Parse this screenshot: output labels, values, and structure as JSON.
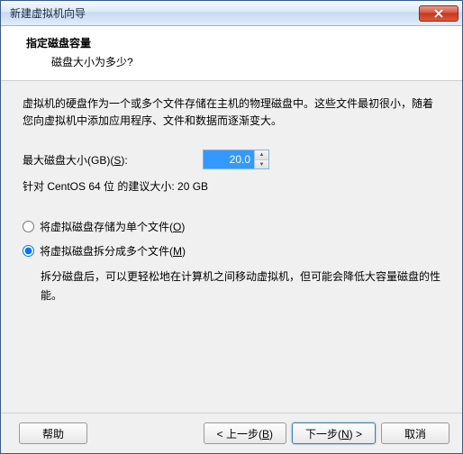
{
  "window": {
    "title": "新建虚拟机向导"
  },
  "header": {
    "title": "指定磁盘容量",
    "subtitle": "磁盘大小为多少?"
  },
  "content": {
    "description": "虚拟机的硬盘作为一个或多个文件存储在主机的物理磁盘中。这些文件最初很小，随着您向虚拟机中添加应用程序、文件和数据而逐渐变大。",
    "size_label_prefix": "最大磁盘大小(GB)(",
    "size_label_key": "S",
    "size_label_suffix": "):",
    "size_value": "20.0",
    "recommend": "针对 CentOS 64 位 的建议大小: 20 GB",
    "radio1_prefix": "将虚拟磁盘存储为单个文件(",
    "radio1_key": "O",
    "radio1_suffix": ")",
    "radio2_prefix": "将虚拟磁盘拆分成多个文件(",
    "radio2_key": "M",
    "radio2_suffix": ")",
    "radio2_desc": "拆分磁盘后，可以更轻松地在计算机之间移动虚拟机，但可能会降低大容量磁盘的性能。"
  },
  "footer": {
    "help": "帮助",
    "back_prefix": "< 上一步(",
    "back_key": "B",
    "back_suffix": ")",
    "next_prefix": "下一步(",
    "next_key": "N",
    "next_suffix": ") >",
    "cancel": "取消"
  }
}
